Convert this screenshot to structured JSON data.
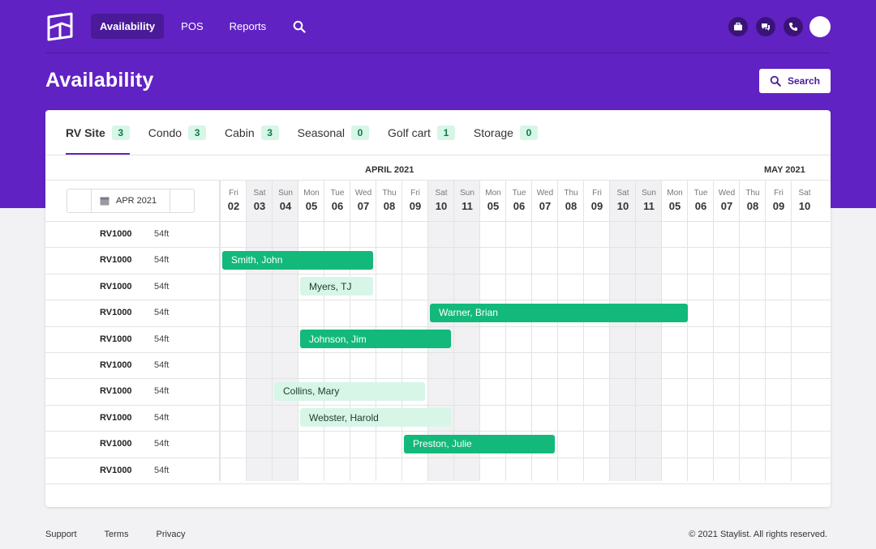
{
  "nav": {
    "items": [
      "Availability",
      "POS",
      "Reports"
    ],
    "active": "Availability"
  },
  "page": {
    "title": "Availability",
    "search_label": "Search"
  },
  "tabs": [
    {
      "label": "RV Site",
      "count": "3"
    },
    {
      "label": "Condo",
      "count": "3"
    },
    {
      "label": "Cabin",
      "count": "3"
    },
    {
      "label": "Seasonal",
      "count": "0"
    },
    {
      "label": "Golf cart",
      "count": "1"
    },
    {
      "label": "Storage",
      "count": "0"
    }
  ],
  "calendar": {
    "picker_label": "APR 2021",
    "months": [
      "APRIL 2021",
      "MAY 2021"
    ],
    "days": [
      {
        "name": "Fri",
        "num": "02",
        "weekend": false
      },
      {
        "name": "Sat",
        "num": "03",
        "weekend": true
      },
      {
        "name": "Sun",
        "num": "04",
        "weekend": true
      },
      {
        "name": "Mon",
        "num": "05",
        "weekend": false
      },
      {
        "name": "Tue",
        "num": "06",
        "weekend": false
      },
      {
        "name": "Wed",
        "num": "07",
        "weekend": false
      },
      {
        "name": "Thu",
        "num": "08",
        "weekend": false
      },
      {
        "name": "Fri",
        "num": "09",
        "weekend": false
      },
      {
        "name": "Sat",
        "num": "10",
        "weekend": true
      },
      {
        "name": "Sun",
        "num": "11",
        "weekend": true
      },
      {
        "name": "Mon",
        "num": "05",
        "weekend": false
      },
      {
        "name": "Tue",
        "num": "06",
        "weekend": false
      },
      {
        "name": "Wed",
        "num": "07",
        "weekend": false
      },
      {
        "name": "Thu",
        "num": "08",
        "weekend": false
      },
      {
        "name": "Fri",
        "num": "09",
        "weekend": false
      },
      {
        "name": "Sat",
        "num": "10",
        "weekend": true
      },
      {
        "name": "Sun",
        "num": "11",
        "weekend": true
      },
      {
        "name": "Mon",
        "num": "05",
        "weekend": false
      },
      {
        "name": "Tue",
        "num": "06",
        "weekend": false
      },
      {
        "name": "Wed",
        "num": "07",
        "weekend": false
      },
      {
        "name": "Thu",
        "num": "08",
        "weekend": false
      },
      {
        "name": "Fri",
        "num": "09",
        "weekend": false
      },
      {
        "name": "Sat",
        "num": "10",
        "weekend": false
      }
    ],
    "rows": [
      {
        "site": "RV1000",
        "size": "54ft"
      },
      {
        "site": "RV1000",
        "size": "54ft"
      },
      {
        "site": "RV1000",
        "size": "54ft"
      },
      {
        "site": "RV1000",
        "size": "54ft"
      },
      {
        "site": "RV1000",
        "size": "54ft"
      },
      {
        "site": "RV1000",
        "size": "54ft"
      },
      {
        "site": "RV1000",
        "size": "54ft"
      },
      {
        "site": "RV1000",
        "size": "54ft"
      },
      {
        "site": "RV1000",
        "size": "54ft"
      },
      {
        "site": "RV1000",
        "size": "54ft"
      }
    ],
    "bookings": [
      {
        "name": "Smith, John",
        "row": 1,
        "start": 0,
        "span": 6,
        "status": "confirmed"
      },
      {
        "name": "Myers, TJ",
        "row": 2,
        "start": 3,
        "span": 3,
        "status": "pending"
      },
      {
        "name": "Warner, Brian",
        "row": 3,
        "start": 8,
        "span": 10,
        "status": "confirmed"
      },
      {
        "name": "Johnson, Jim",
        "row": 4,
        "start": 3,
        "span": 6,
        "status": "confirmed"
      },
      {
        "name": "Collins, Mary",
        "row": 6,
        "start": 2,
        "span": 6,
        "status": "pending"
      },
      {
        "name": "Webster, Harold",
        "row": 7,
        "start": 3,
        "span": 6,
        "status": "pending"
      },
      {
        "name": "Preston, Julie",
        "row": 8,
        "start": 7,
        "span": 6,
        "status": "confirmed"
      }
    ]
  },
  "footer": {
    "links": [
      "Support",
      "Terms",
      "Privacy"
    ],
    "copyright": "© 2021 Staylist. All rights reserved."
  },
  "colors": {
    "brand": "#6122c3",
    "confirmed": "#12b97b",
    "pending": "#d7f6e7",
    "badge": "#d7f6e7"
  }
}
